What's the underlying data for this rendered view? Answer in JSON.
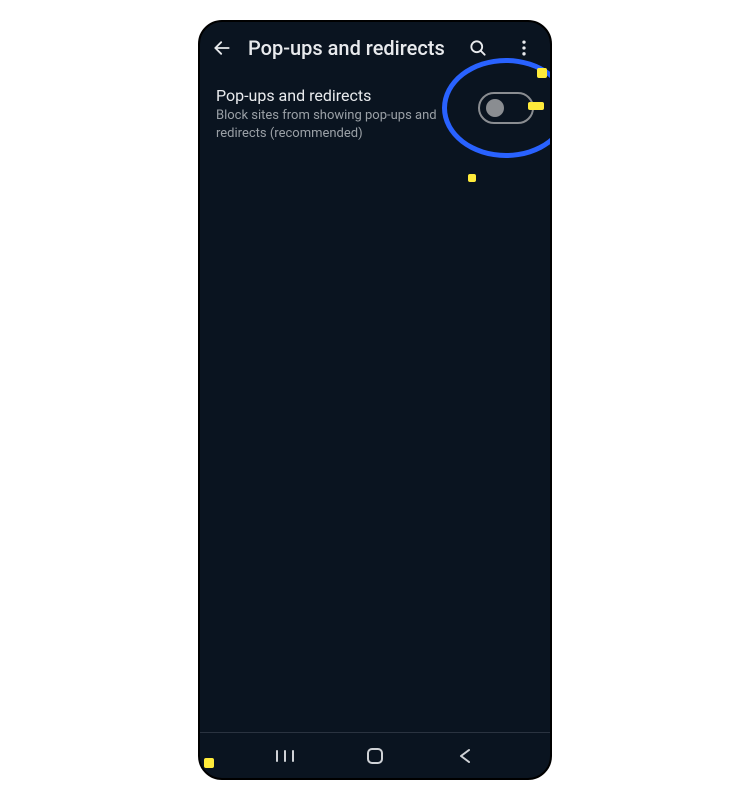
{
  "header": {
    "title": "Pop-ups and redirects"
  },
  "setting": {
    "title": "Pop-ups and redirects",
    "subtitle": "Block sites from showing pop-ups and redirects (recommended)",
    "toggle_state": "off"
  }
}
